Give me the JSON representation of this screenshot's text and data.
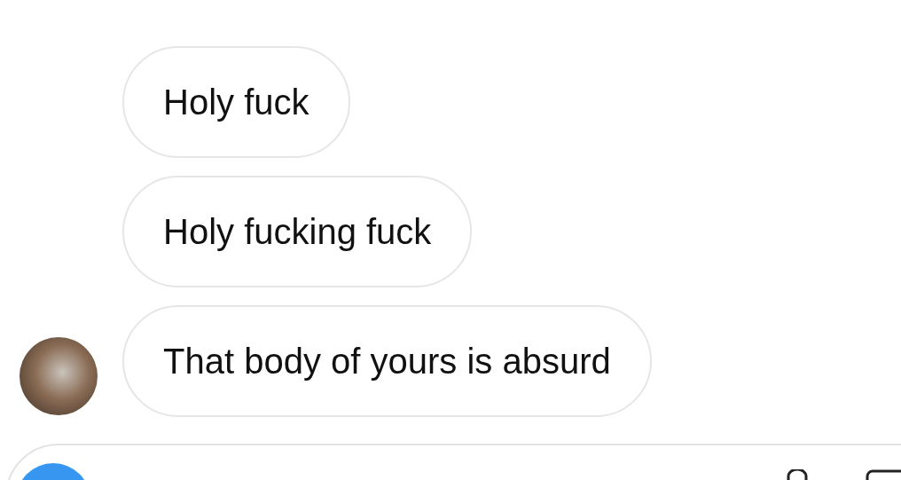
{
  "messages": [
    {
      "text": "Holy fuck",
      "avatar": false
    },
    {
      "text": "Holy fucking fuck",
      "avatar": false
    },
    {
      "text": "That body of yours is absurd",
      "avatar": true
    }
  ]
}
